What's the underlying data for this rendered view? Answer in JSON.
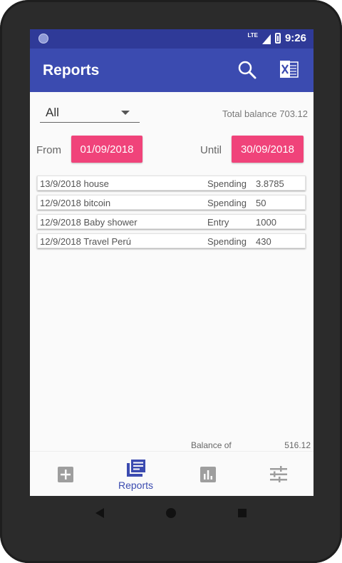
{
  "status": {
    "network": "LTE",
    "time": "9:26"
  },
  "appbar": {
    "title": "Reports",
    "search_icon": "search-icon",
    "export_icon": "excel-icon"
  },
  "filter": {
    "selected": "All"
  },
  "total": {
    "label": "Total balance",
    "value": "703.12"
  },
  "range": {
    "from_label": "From",
    "from_date": "01/09/2018",
    "until_label": "Until",
    "until_date": "30/09/2018"
  },
  "transactions": [
    {
      "date": "13/9/2018",
      "description": "house",
      "type": "Spending",
      "amount": "3.8785"
    },
    {
      "date": "12/9/2018",
      "description": "bitcoin",
      "type": "Spending",
      "amount": "50"
    },
    {
      "date": "12/9/2018",
      "description": "Baby shower",
      "type": "Entry",
      "amount": "1000"
    },
    {
      "date": "12/9/2018",
      "description": "Travel Perú",
      "type": "Spending",
      "amount": "430"
    }
  ],
  "balance": {
    "label": "Balance of",
    "value": "516.12"
  },
  "bottom_nav": [
    {
      "icon": "add-icon",
      "label": ""
    },
    {
      "icon": "reports-icon",
      "label": "Reports"
    },
    {
      "icon": "chart-icon",
      "label": ""
    },
    {
      "icon": "settings-icon",
      "label": ""
    }
  ],
  "colors": {
    "primary": "#3b4bb0",
    "status_bar": "#2f3a98",
    "accent": "#f0437a"
  }
}
